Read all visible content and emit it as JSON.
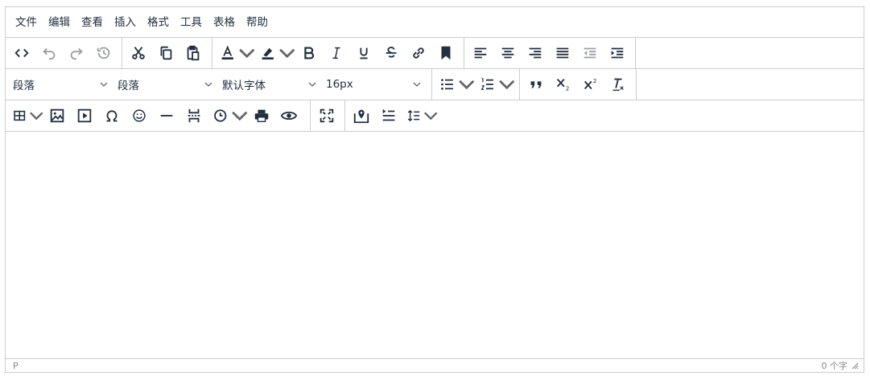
{
  "menubar": {
    "items": [
      "文件",
      "编辑",
      "查看",
      "插入",
      "格式",
      "工具",
      "表格",
      "帮助"
    ]
  },
  "toolbar": {
    "block_format": "段落",
    "paragraph": "段落",
    "font_family": "默认字体",
    "font_size": "16px"
  },
  "statusbar": {
    "path": "P",
    "word_count": "0 个字"
  },
  "colors": {
    "text": "#222f3e",
    "border": "#cccccc",
    "status": "#888888"
  }
}
